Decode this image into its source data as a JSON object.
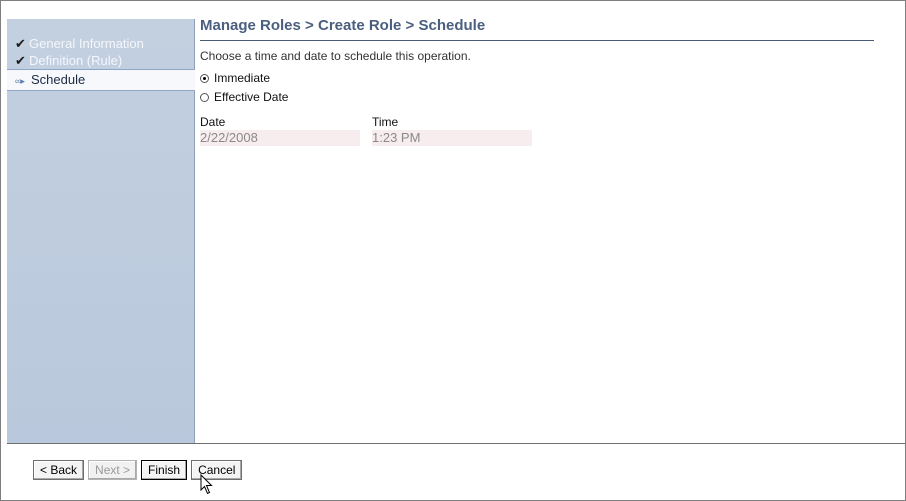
{
  "wizard": {
    "steps": [
      {
        "label": "General Information",
        "status": "completed",
        "icon": "checkmark-icon"
      },
      {
        "label": "Definition (Rule)",
        "status": "completed",
        "icon": "checkmark-icon"
      },
      {
        "label": "Schedule",
        "status": "current",
        "icon": "current-step-arrow-icon"
      }
    ]
  },
  "main": {
    "title": {
      "crumb1": "Manage Roles",
      "sep1": " > ",
      "crumb2": "Create Role",
      "sep2": " > ",
      "current": "Schedule"
    },
    "instructions": "Choose a time and date to schedule this operation.",
    "options": [
      {
        "label": "Immediate",
        "checked": true
      },
      {
        "label": "Effective Date",
        "checked": false
      }
    ],
    "date": {
      "label": "Date",
      "value": "2/22/2008"
    },
    "time": {
      "label": "Time",
      "value": "1:23 PM"
    }
  },
  "buttons": {
    "back": "< Back",
    "next": "Next >",
    "finish": "Finish",
    "cancel": "Cancel"
  },
  "colors": {
    "sidebar_bg": "#c3d0e0",
    "title": "#4a5f7f",
    "field_bg": "#f7ecee"
  }
}
